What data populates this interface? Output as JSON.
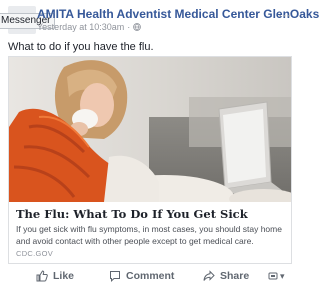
{
  "post": {
    "page_name": "AMITA Health Adventist Medical Center GlenOaks",
    "timestamp": "Yesterday at 10:30am",
    "separator": "·",
    "message": "What to do if you have the flu.",
    "tooltip": "Messenger"
  },
  "link": {
    "title": "The Flu: What To Do If You Get Sick",
    "description": "If you get sick with flu symptoms, in most cases, you should stay home and avoid contact with other people except to get medical care.",
    "domain": "CDC.GOV"
  },
  "actions": {
    "like": "Like",
    "comment": "Comment",
    "share": "Share"
  },
  "icons": {
    "globe": "globe-icon",
    "like": "thumbs-up-icon",
    "comment": "comment-bubble-icon",
    "share": "share-arrow-icon",
    "more": "ellipsis-icon",
    "audience": "audience-selector-icon"
  },
  "colors": {
    "page_name": "#365899",
    "meta": "#90949c",
    "action": "#606770",
    "card_border": "#dddfe2"
  }
}
